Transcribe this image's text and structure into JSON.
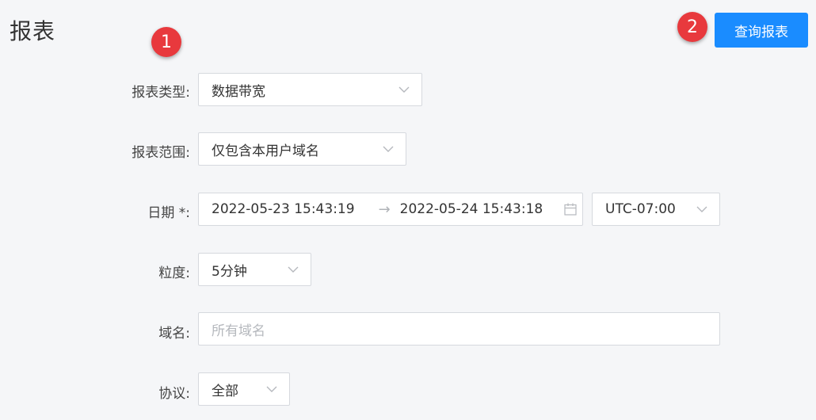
{
  "page_title": "报表",
  "badges": {
    "one": "1",
    "two": "2"
  },
  "query_button": "查询报表",
  "form": {
    "report_type": {
      "label": "报表类型:",
      "value": "数据带宽"
    },
    "report_scope": {
      "label": "报表范围:",
      "value": "仅包含本用户域名"
    },
    "date": {
      "label": "日期 *:",
      "start": "2022-05-23 15:43:19",
      "separator": "→",
      "end": "2022-05-24 15:43:18",
      "timezone": "UTC-07:00"
    },
    "granularity": {
      "label": "粒度:",
      "value": "5分钟"
    },
    "domain": {
      "label": "域名:",
      "placeholder": "所有域名"
    },
    "protocol": {
      "label": "协议:",
      "value": "全部"
    }
  },
  "colors": {
    "primary": "#1a8cff",
    "badge": "#e8393d",
    "background": "#f5f6f8"
  }
}
